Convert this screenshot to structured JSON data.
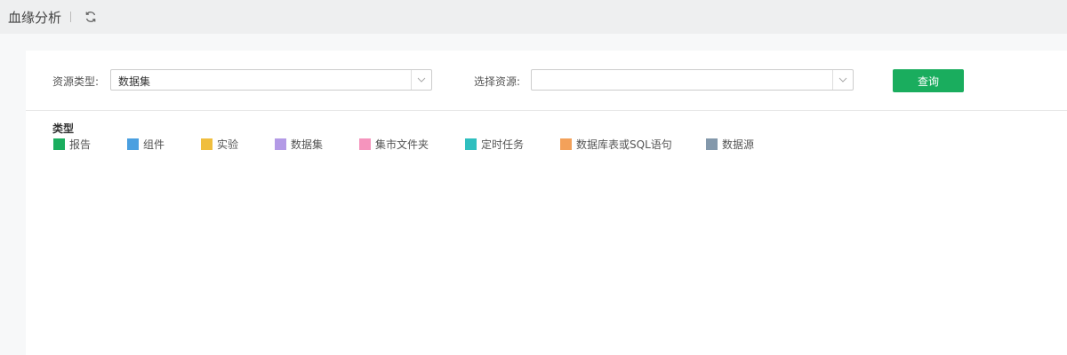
{
  "header": {
    "title": "血缘分析",
    "refresh_icon": "refresh-icon"
  },
  "filters": {
    "resource_type_label": "资源类型:",
    "resource_type_value": "数据集",
    "resource_select_label": "选择资源:",
    "resource_select_value": "",
    "query_button": "查询"
  },
  "legend": {
    "title": "类型",
    "items": [
      {
        "label": "报告",
        "color": "#1aad5e"
      },
      {
        "label": "组件",
        "color": "#4a9fe0"
      },
      {
        "label": "实验",
        "color": "#f0be3e"
      },
      {
        "label": "数据集",
        "color": "#b39ae6"
      },
      {
        "label": "集市文件夹",
        "color": "#f594bd"
      },
      {
        "label": "定时任务",
        "color": "#2fbfbf"
      },
      {
        "label": "数据库表或SQL语句",
        "color": "#f3a15a"
      },
      {
        "label": "数据源",
        "color": "#8398ab"
      }
    ]
  }
}
